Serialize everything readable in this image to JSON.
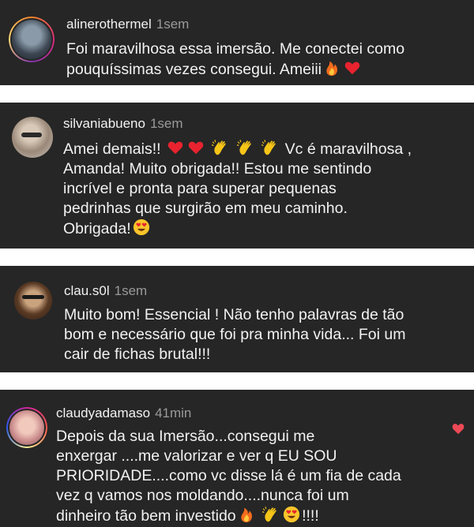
{
  "comments": [
    {
      "username": "alinerothermel",
      "time": "1sem",
      "text": "Foi maravilhosa essa imersão. Me conectei como\npouquíssimas vezes consegui. Ameiii"
    },
    {
      "username": "silvaniabueno",
      "time": "1sem",
      "text_a": "Amei demais!!",
      "text_b": "Vc é maravilhosa ,",
      "text_c": "Amanda! Muito obrigada!! Estou me sentindo\nincrível e pronta para superar pequenas\npedrinhas que surgirão em meu caminho.\nObrigada!"
    },
    {
      "username": "clau.s0l",
      "time": "1sem",
      "text": "Muito bom! Essencial ! Não tenho palavras de tão\nbom e necessário que foi pra minha vida... Foi um\ncair de fichas brutal!!!"
    },
    {
      "username": "claudyadamaso",
      "time": "41min",
      "text": "Depois da sua Imersão...consegui me\nenxergar ....me valorizar e ver q EU SOU\nPRIORIDADE....como vc disse lá é um fia  de cada\nvez q vamos nos moldando....nunca foi um\ndinheiro tão bem investido",
      "text_end": "!!!!"
    }
  ],
  "icons": [
    "fire-emoji",
    "heart-emoji",
    "clap-emoji",
    "heart-eyes-emoji",
    "like-heart-icon"
  ],
  "colors": {
    "card": "#262626",
    "text": "#f2f2f2",
    "time": "#9a9a9a",
    "like": "#ed4956",
    "story_ring": "#d6249f"
  }
}
